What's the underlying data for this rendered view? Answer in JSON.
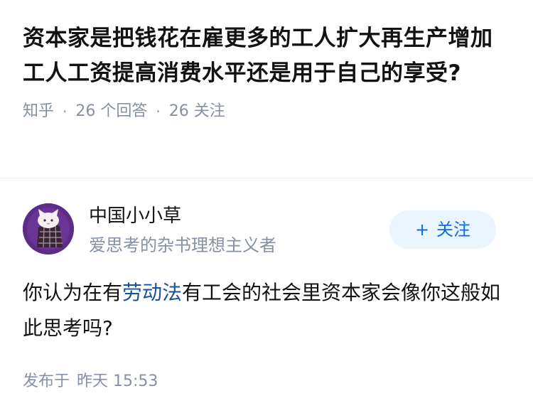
{
  "question": {
    "title": "资本家是把钱花在雇更多的工人扩大再生产增加工人工资提高消费水平还是用于自己的享受?",
    "source": "知乎",
    "answer_count": "26 个回答",
    "follower_count": "26 关注"
  },
  "author": {
    "name": "中国小小草",
    "bio": "爱思考的杂书理想主义者",
    "avatar_icon": "cat-avatar-icon",
    "follow_plus": "+",
    "follow_label": "关注"
  },
  "answer": {
    "text_before": "你认为在有",
    "link_text": "劳动法",
    "text_after": "有工会的社会里资本家会像你这般如此思考吗?"
  },
  "footer": {
    "published_label": "发布于",
    "published_time": "昨天 15:53"
  },
  "colors": {
    "meta_gray": "#8590a6",
    "link_blue": "#175199",
    "follow_blue": "#056de8",
    "follow_bg": "#ebf5ff",
    "avatar_bg": "#5b2d86"
  }
}
